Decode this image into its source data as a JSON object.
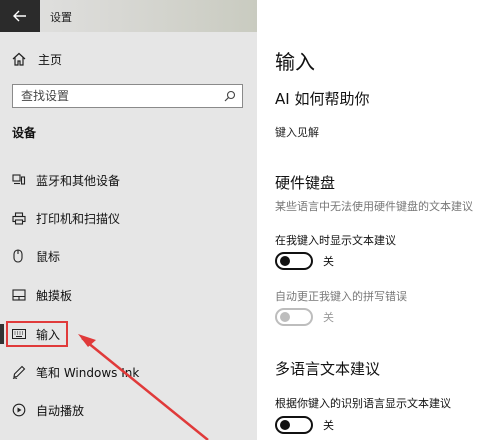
{
  "window": {
    "title": "设置"
  },
  "sidebar": {
    "home_label": "主页",
    "search_placeholder": "查找设置",
    "section_label": "设备",
    "items": [
      {
        "label": "蓝牙和其他设备",
        "icon": "bluetooth-devices-icon"
      },
      {
        "label": "打印机和扫描仪",
        "icon": "printer-icon"
      },
      {
        "label": "鼠标",
        "icon": "mouse-icon"
      },
      {
        "label": "触摸板",
        "icon": "touchpad-icon"
      },
      {
        "label": "输入",
        "icon": "keyboard-icon",
        "selected": true
      },
      {
        "label": "笔和 Windows Ink",
        "icon": "pen-icon"
      },
      {
        "label": "自动播放",
        "icon": "autoplay-icon"
      }
    ]
  },
  "main": {
    "title": "输入",
    "ai_section": {
      "heading": "AI 如何帮助你",
      "link": "键入见解"
    },
    "hw_section": {
      "heading": "硬件键盘",
      "description": "某些语言中无法使用硬件键盘的文本建议",
      "show_suggestions_label": "在我键入时显示文本建议",
      "show_suggestions_state": "关",
      "autocorrect_label": "自动更正我键入的拼写错误",
      "autocorrect_state": "关"
    },
    "multi_section": {
      "heading": "多语言文本建议",
      "label": "根据你键入的识别语言显示文本建议",
      "state": "关"
    }
  },
  "colors": {
    "highlight_frame": "#e03a3a",
    "back_button": "#2b2b2b",
    "sidebar_bg": "#e6e6e6"
  }
}
